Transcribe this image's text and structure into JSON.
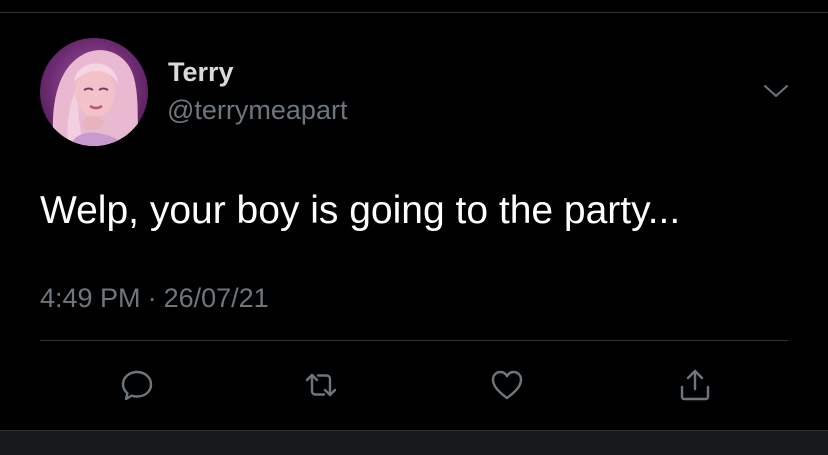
{
  "tweet": {
    "author": {
      "display_name": "Terry",
      "handle": "@terrymeapart",
      "avatar_icon": "profile-avatar"
    },
    "text": "Welp, your boy is going to the party...",
    "time": "4:49 PM",
    "separator": "·",
    "date": "26/07/21"
  },
  "actions": [
    {
      "name": "reply",
      "icon": "speech-bubble-icon"
    },
    {
      "name": "retweet",
      "icon": "retweet-arrows-icon"
    },
    {
      "name": "like",
      "icon": "heart-icon"
    },
    {
      "name": "share",
      "icon": "share-upload-icon"
    }
  ],
  "colors": {
    "background": "#000000",
    "primary_text": "#ffffff",
    "secondary_text": "#6e767d",
    "divider": "#2f3336",
    "icon": "#6e767d"
  }
}
